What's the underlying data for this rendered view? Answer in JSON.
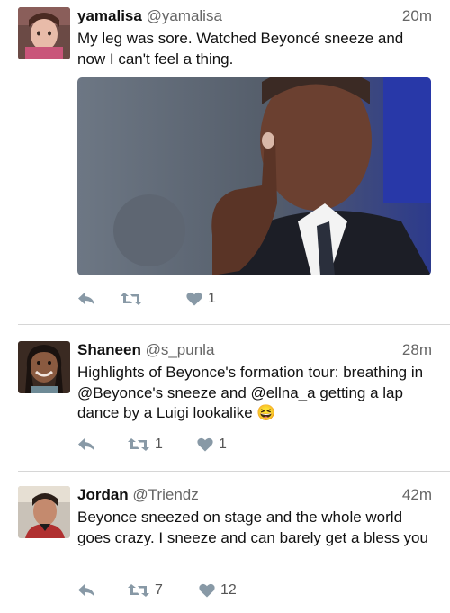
{
  "tweets": [
    {
      "name": "yamalisa",
      "handle": "@yamalisa",
      "time": "20m",
      "text": "My leg was sore. Watched Beyoncé sneeze and now I can't feel a thing.",
      "retweets": "",
      "likes": "1"
    },
    {
      "name": "Shaneen",
      "handle": "@s_punla",
      "time": "28m",
      "text": "Highlights of Beyonce's formation tour: breathing in @Beyonce's sneeze and @ellna_a getting a lap dance by a Luigi lookalike",
      "emoji": "😆",
      "retweets": "1",
      "likes": "1"
    },
    {
      "name": "Jordan",
      "handle": "@Triendz",
      "time": "42m",
      "text": "Beyonce sneezed on stage and the whole world goes crazy. I sneeze and can barely get a bless you",
      "retweets": "7",
      "likes": "12"
    }
  ],
  "colors": {
    "icon": "#8899a6",
    "divider": "#d6d6d6",
    "muted_text": "#666666"
  },
  "icons": [
    "reply-icon",
    "retweet-icon",
    "like-icon"
  ]
}
